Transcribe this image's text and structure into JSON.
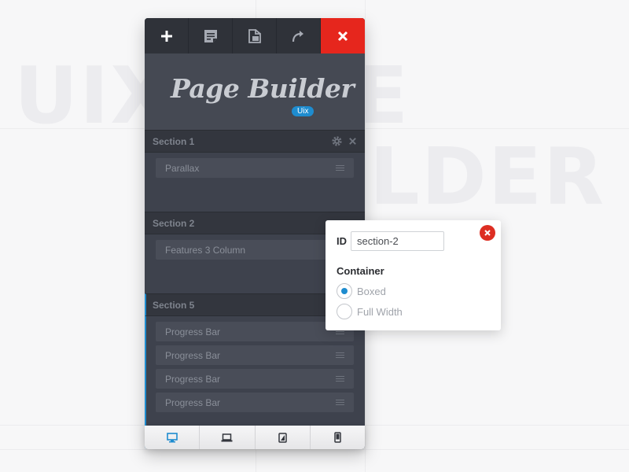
{
  "background": {
    "word_line1": "UIX    GE",
    "word_line2": "LDER"
  },
  "toolbar": {
    "items": [
      {
        "icon": "plus-icon"
      },
      {
        "icon": "notes-icon"
      },
      {
        "icon": "duplicate-icon"
      },
      {
        "icon": "redo-icon"
      },
      {
        "icon": "close-icon"
      }
    ],
    "close_color": "#e6261d"
  },
  "logo": {
    "text": "Page Builder",
    "badge": "Uix"
  },
  "sections": [
    {
      "title": "Section 1",
      "modules": [
        "Parallax"
      ]
    },
    {
      "title": "Section 2",
      "modules": [
        "Features 3 Column"
      ]
    },
    {
      "title": "Section 5",
      "modules": [
        "Progress Bar",
        "Progress Bar",
        "Progress Bar",
        "Progress Bar"
      ]
    }
  ],
  "devices": [
    {
      "icon": "desktop-icon",
      "active": true
    },
    {
      "icon": "laptop-icon",
      "active": false
    },
    {
      "icon": "tablet-icon",
      "active": false
    },
    {
      "icon": "phone-icon",
      "active": false
    }
  ],
  "popover": {
    "id_label": "ID",
    "id_value": "section-2",
    "container_label": "Container",
    "options": [
      {
        "label": "Boxed",
        "checked": true
      },
      {
        "label": "Full Width",
        "checked": false
      }
    ]
  },
  "accent_color": "#1e8ccf"
}
